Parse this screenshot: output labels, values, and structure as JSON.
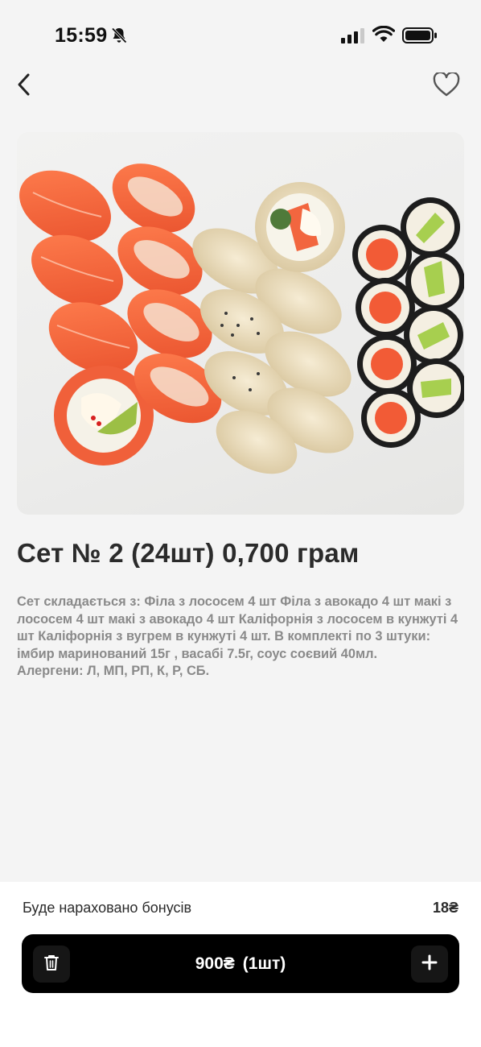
{
  "status_bar": {
    "time": "15:59",
    "icons": [
      "bell-off-icon",
      "signal-icon",
      "wifi-icon",
      "battery-icon"
    ]
  },
  "nav": {
    "back_icon": "chevron-left-icon",
    "favorite_icon": "heart-outline-icon"
  },
  "product": {
    "image_alt": "sushi-set-photo",
    "title": "Сет № 2 (24шт) 0,700 грам",
    "description": "Сет складається з: Філа з лососем 4 шт  Філа з авокадо 4 шт  макі з лососем 4 шт  макі з авокадо 4 шт  Каліфорнія з лососем в кунжуті 4 шт  Каліфорнія з вугрем в кунжуті 4 шт. В комплекті по 3 штуки: імбир маринований 15г , васабі 7.5г, соус соєвий 40мл.\nАлергени: Л, МП, РП, К, Р, СБ."
  },
  "bonus": {
    "label": "Буде нараховано бонусів",
    "value": "18₴"
  },
  "cart": {
    "price": "900₴",
    "quantity": "(1шт)",
    "delete_icon": "trash-icon",
    "add_icon": "plus-icon"
  },
  "colors": {
    "background": "#f4f4f4",
    "cart_bar": "#000000",
    "text_primary": "#2b2b2b",
    "text_secondary": "#8a8a8a",
    "heart_outline": "#555555"
  }
}
